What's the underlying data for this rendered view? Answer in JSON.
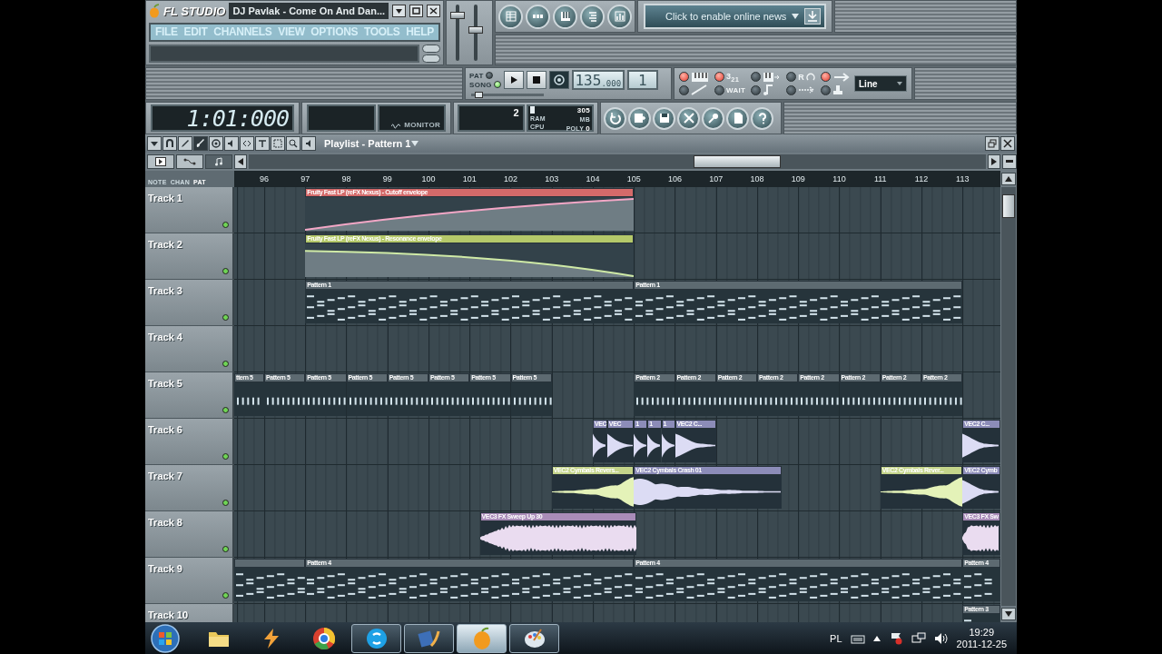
{
  "window": {
    "logo": "FL STUDIO",
    "title": "DJ Pavlak - Come On And Dan..."
  },
  "menu": [
    "FILE",
    "EDIT",
    "CHANNELS",
    "VIEW",
    "OPTIONS",
    "TOOLS",
    "HELP"
  ],
  "mixer_sliders": [
    {
      "level": 0.85
    },
    {
      "level": 0.55
    }
  ],
  "news": {
    "text": "Click to enable online news"
  },
  "transport": {
    "modes": [
      {
        "label": "PAT",
        "selected": false
      },
      {
        "label": "SONG",
        "selected": true
      }
    ],
    "tempo": "135",
    "tempo_fraction": ".000",
    "pattern": "1",
    "pitch": {
      "level": 0.05
    }
  },
  "record_options": [
    {
      "on": true
    },
    {
      "on": true,
      "label": "3$_{2}$$_{1}$"
    },
    {
      "on": false
    },
    {
      "on": false,
      "label": "R"
    },
    {
      "on": true
    },
    {
      "on": false
    },
    {
      "on": false,
      "label": "WAIT"
    },
    {
      "on": false
    },
    {
      "on": false
    },
    {
      "on": false
    }
  ],
  "snap": {
    "value": "Line"
  },
  "time": "1:01:000",
  "monitor": {
    "label": "MONITOR"
  },
  "cpu": {
    "cpu_value": "2",
    "ram_value": "305",
    "ram_label": "RAM",
    "mb_label": "MB",
    "cpu_label": "CPU",
    "poly_label": "POLY",
    "poly_value": "0"
  },
  "playlist": {
    "title": "Playlist - Pattern 1",
    "tools": [
      {
        "selected": false
      },
      {
        "selected": false
      },
      {
        "selected": false
      },
      {
        "selected": true
      },
      {
        "selected": false
      },
      {
        "selected": false
      },
      {
        "selected": false
      },
      {
        "selected": false
      },
      {
        "selected": false
      },
      {
        "selected": false
      },
      {
        "selected": false
      }
    ],
    "view_tabs": [
      {
        "selected": false
      },
      {
        "selected": false
      },
      {
        "selected": true
      }
    ],
    "filters": [
      {
        "label": "NOTE",
        "selected": false
      },
      {
        "label": "CHAN",
        "selected": false
      },
      {
        "label": "PAT",
        "selected": true
      }
    ],
    "ruler": [
      "96",
      "97",
      "98",
      "99",
      "100",
      "101",
      "102",
      "103",
      "104",
      "105",
      "106",
      "107",
      "108",
      "109",
      "110",
      "111",
      "112",
      "113"
    ],
    "tracks": [
      {
        "name": "Track 1",
        "enabled": true,
        "clips": [
          {
            "kind": "rise",
            "label": "Fruity Fast LP (reFX Nexus) - Cutoff envelope",
            "color": "#d46a6a"
          }
        ]
      },
      {
        "name": "Track 2",
        "enabled": true,
        "clips": [
          {
            "kind": "fall",
            "label": "Fruity Fast LP (reFX Nexus) - Resonance envelope",
            "color": "#b5c96a"
          }
        ]
      },
      {
        "name": "Track 3",
        "enabled": true,
        "clips": [
          {
            "kind": "pattern",
            "label": "Pattern 1",
            "color": "#5d6a71"
          },
          {
            "kind": "pattern",
            "label": "Pattern 1",
            "color": "#5d6a71"
          }
        ]
      },
      {
        "name": "Track 4",
        "enabled": true
      },
      {
        "name": "Track 5",
        "enabled": true,
        "clips": [
          {
            "kind": "beat",
            "label": "ttern 5",
            "color": "#5d6a71"
          },
          {
            "kind": "beat",
            "label": "Pattern 5",
            "color": "#5d6a71"
          },
          {
            "kind": "beat",
            "label": "Pattern 5",
            "color": "#5d6a71"
          },
          {
            "kind": "beat",
            "label": "Pattern 5",
            "color": "#5d6a71"
          },
          {
            "kind": "beat",
            "label": "Pattern 5",
            "color": "#5d6a71"
          },
          {
            "kind": "beat",
            "label": "Pattern 5",
            "color": "#5d6a71"
          },
          {
            "kind": "beat",
            "label": "Pattern 5",
            "color": "#5d6a71"
          },
          {
            "kind": "beat",
            "label": "Pattern 5",
            "color": "#5d6a71"
          },
          {
            "kind": "beat",
            "label": "Pattern 2",
            "color": "#5d6a71"
          },
          {
            "kind": "beat",
            "label": "Pattern 2",
            "color": "#5d6a71"
          },
          {
            "kind": "beat",
            "label": "Pattern 2",
            "color": "#5d6a71"
          },
          {
            "kind": "beat",
            "label": "Pattern 2",
            "color": "#5d6a71"
          },
          {
            "kind": "beat",
            "label": "Pattern 2",
            "color": "#5d6a71"
          },
          {
            "kind": "beat",
            "label": "Pattern 2",
            "color": "#5d6a71"
          },
          {
            "kind": "beat",
            "label": "Pattern 2",
            "color": "#5d6a71"
          },
          {
            "kind": "beat",
            "label": "Pattern 2",
            "color": "#5d6a71"
          }
        ]
      },
      {
        "name": "Track 6",
        "enabled": true,
        "clips": [
          {
            "kind": "hit",
            "label": "VEC",
            "color": "#8c8cb8"
          },
          {
            "kind": "hit",
            "label": "VEC",
            "color": "#8c8cb8"
          },
          {
            "kind": "hit",
            "label": "1",
            "color": "#8c8cb8"
          },
          {
            "kind": "hit",
            "label": "1",
            "color": "#8c8cb8"
          },
          {
            "kind": "hit",
            "label": "1",
            "color": "#8c8cb8"
          },
          {
            "kind": "hit",
            "label": "VEC2 C...",
            "color": "#8c8cb8"
          },
          {
            "kind": "hit",
            "label": "VEC2 C...",
            "color": "#8c8cb8"
          }
        ]
      },
      {
        "name": "Track 7",
        "enabled": true,
        "clips": [
          {
            "kind": "swell",
            "label": "VEC2 Cymbals Revers...",
            "color": "#c4d48a"
          },
          {
            "kind": "hit",
            "label": "VEC2 Cymbals Crash 01",
            "color": "#8c8cb8"
          },
          {
            "kind": "swell",
            "label": "VEC2 Cymbals Rever...",
            "color": "#c4d48a"
          },
          {
            "kind": "hit",
            "label": "VEC2 Cymb",
            "color": "#8c8cb8"
          }
        ]
      },
      {
        "name": "Track 8",
        "enabled": true,
        "clips": [
          {
            "kind": "sweep",
            "label": "VEC3 FX Sweep Up 30",
            "color": "#a98cb8"
          },
          {
            "kind": "sweep",
            "label": "VEC3 FX Sw",
            "color": "#a98cb8"
          }
        ]
      },
      {
        "name": "Track 9",
        "enabled": true,
        "clips": [
          {
            "kind": "pattern",
            "color": "#5d6a71"
          },
          {
            "kind": "pattern",
            "label": "Pattern 4",
            "color": "#5d6a71"
          },
          {
            "kind": "pattern",
            "label": "Pattern 4",
            "color": "#5d6a71"
          },
          {
            "kind": "pattern",
            "label": "Pattern 4",
            "color": "#5d6a71"
          }
        ]
      },
      {
        "name": "Track 10",
        "clips": [
          {
            "kind": "pattern",
            "label": "Pattern 3",
            "color": "#5d6a71"
          }
        ]
      }
    ]
  },
  "taskbar": {
    "apps": [
      {
        "running": false,
        "selected": false
      },
      {
        "running": false,
        "selected": false
      },
      {
        "running": false,
        "selected": false
      },
      {
        "running": true,
        "selected": false
      },
      {
        "running": true,
        "selected": false
      },
      {
        "running": true,
        "selected": true
      },
      {
        "running": true,
        "selected": false
      }
    ],
    "language": "PL",
    "time": "19:29",
    "date": "2011-12-25"
  }
}
